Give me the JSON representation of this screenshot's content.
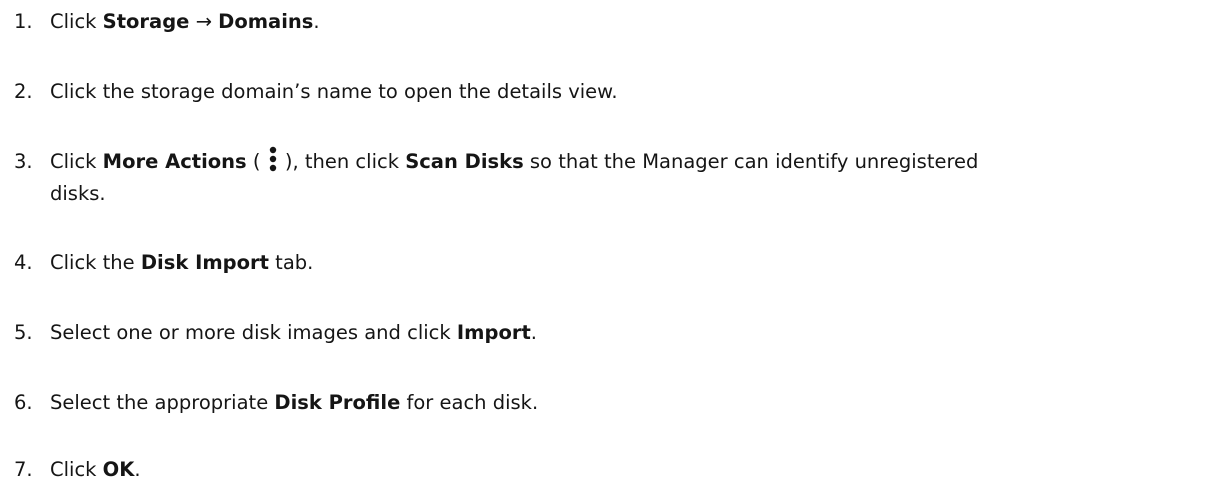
{
  "steps": [
    {
      "number": "1.",
      "text_before": "Click ",
      "bold1": "Storage",
      "arrow": " → ",
      "bold2": "Domains",
      "text_after": "."
    },
    {
      "number": "2.",
      "text": "Click the storage domain’s name to open the details view."
    },
    {
      "number": "3.",
      "text_before": "Click ",
      "bold1": "More Actions",
      "paren_open": " ( ",
      "icon": "kebab-menu-icon",
      "paren_close": " ), then click ",
      "bold2": "Scan Disks",
      "text_after_line1": " so that the Manager can identify unregistered",
      "text_line2": "disks."
    },
    {
      "number": "4.",
      "text_before": "Click the ",
      "bold1": "Disk Import",
      "text_after": " tab."
    },
    {
      "number": "5.",
      "text_before": "Select one or more disk images and click ",
      "bold1": "Import",
      "text_after": "."
    },
    {
      "number": "6.",
      "text_before": "Select the appropriate ",
      "bold1": "Disk Profile",
      "text_after": " for each disk."
    },
    {
      "number": "7.",
      "text_before": "Click ",
      "bold1": "OK",
      "text_after": "."
    }
  ]
}
